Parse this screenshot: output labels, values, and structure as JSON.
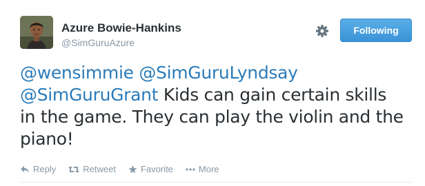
{
  "tweet": {
    "author": {
      "name": "Azure Bowie-Hankins",
      "handle": "@SimGuruAzure"
    },
    "follow_button_label": "Following",
    "text": {
      "mention_1": "@wensimmie",
      "mention_2": "@SimGuruLyndsay",
      "mention_3": "@SimGuruGrant",
      "body": " Kids can gain certain skills in the game.  They can play the violin and the piano!"
    },
    "actions": [
      {
        "label": "Reply",
        "icon": "reply-icon"
      },
      {
        "label": "Retweet",
        "icon": "retweet-icon"
      },
      {
        "label": "Favorite",
        "icon": "star-icon"
      },
      {
        "label": "More",
        "icon": "ellipsis-icon"
      }
    ]
  },
  "colors": {
    "link": "#2b7bb9",
    "muted": "#8899a6",
    "follow_button": "#3a93d8",
    "text": "#292f33"
  }
}
